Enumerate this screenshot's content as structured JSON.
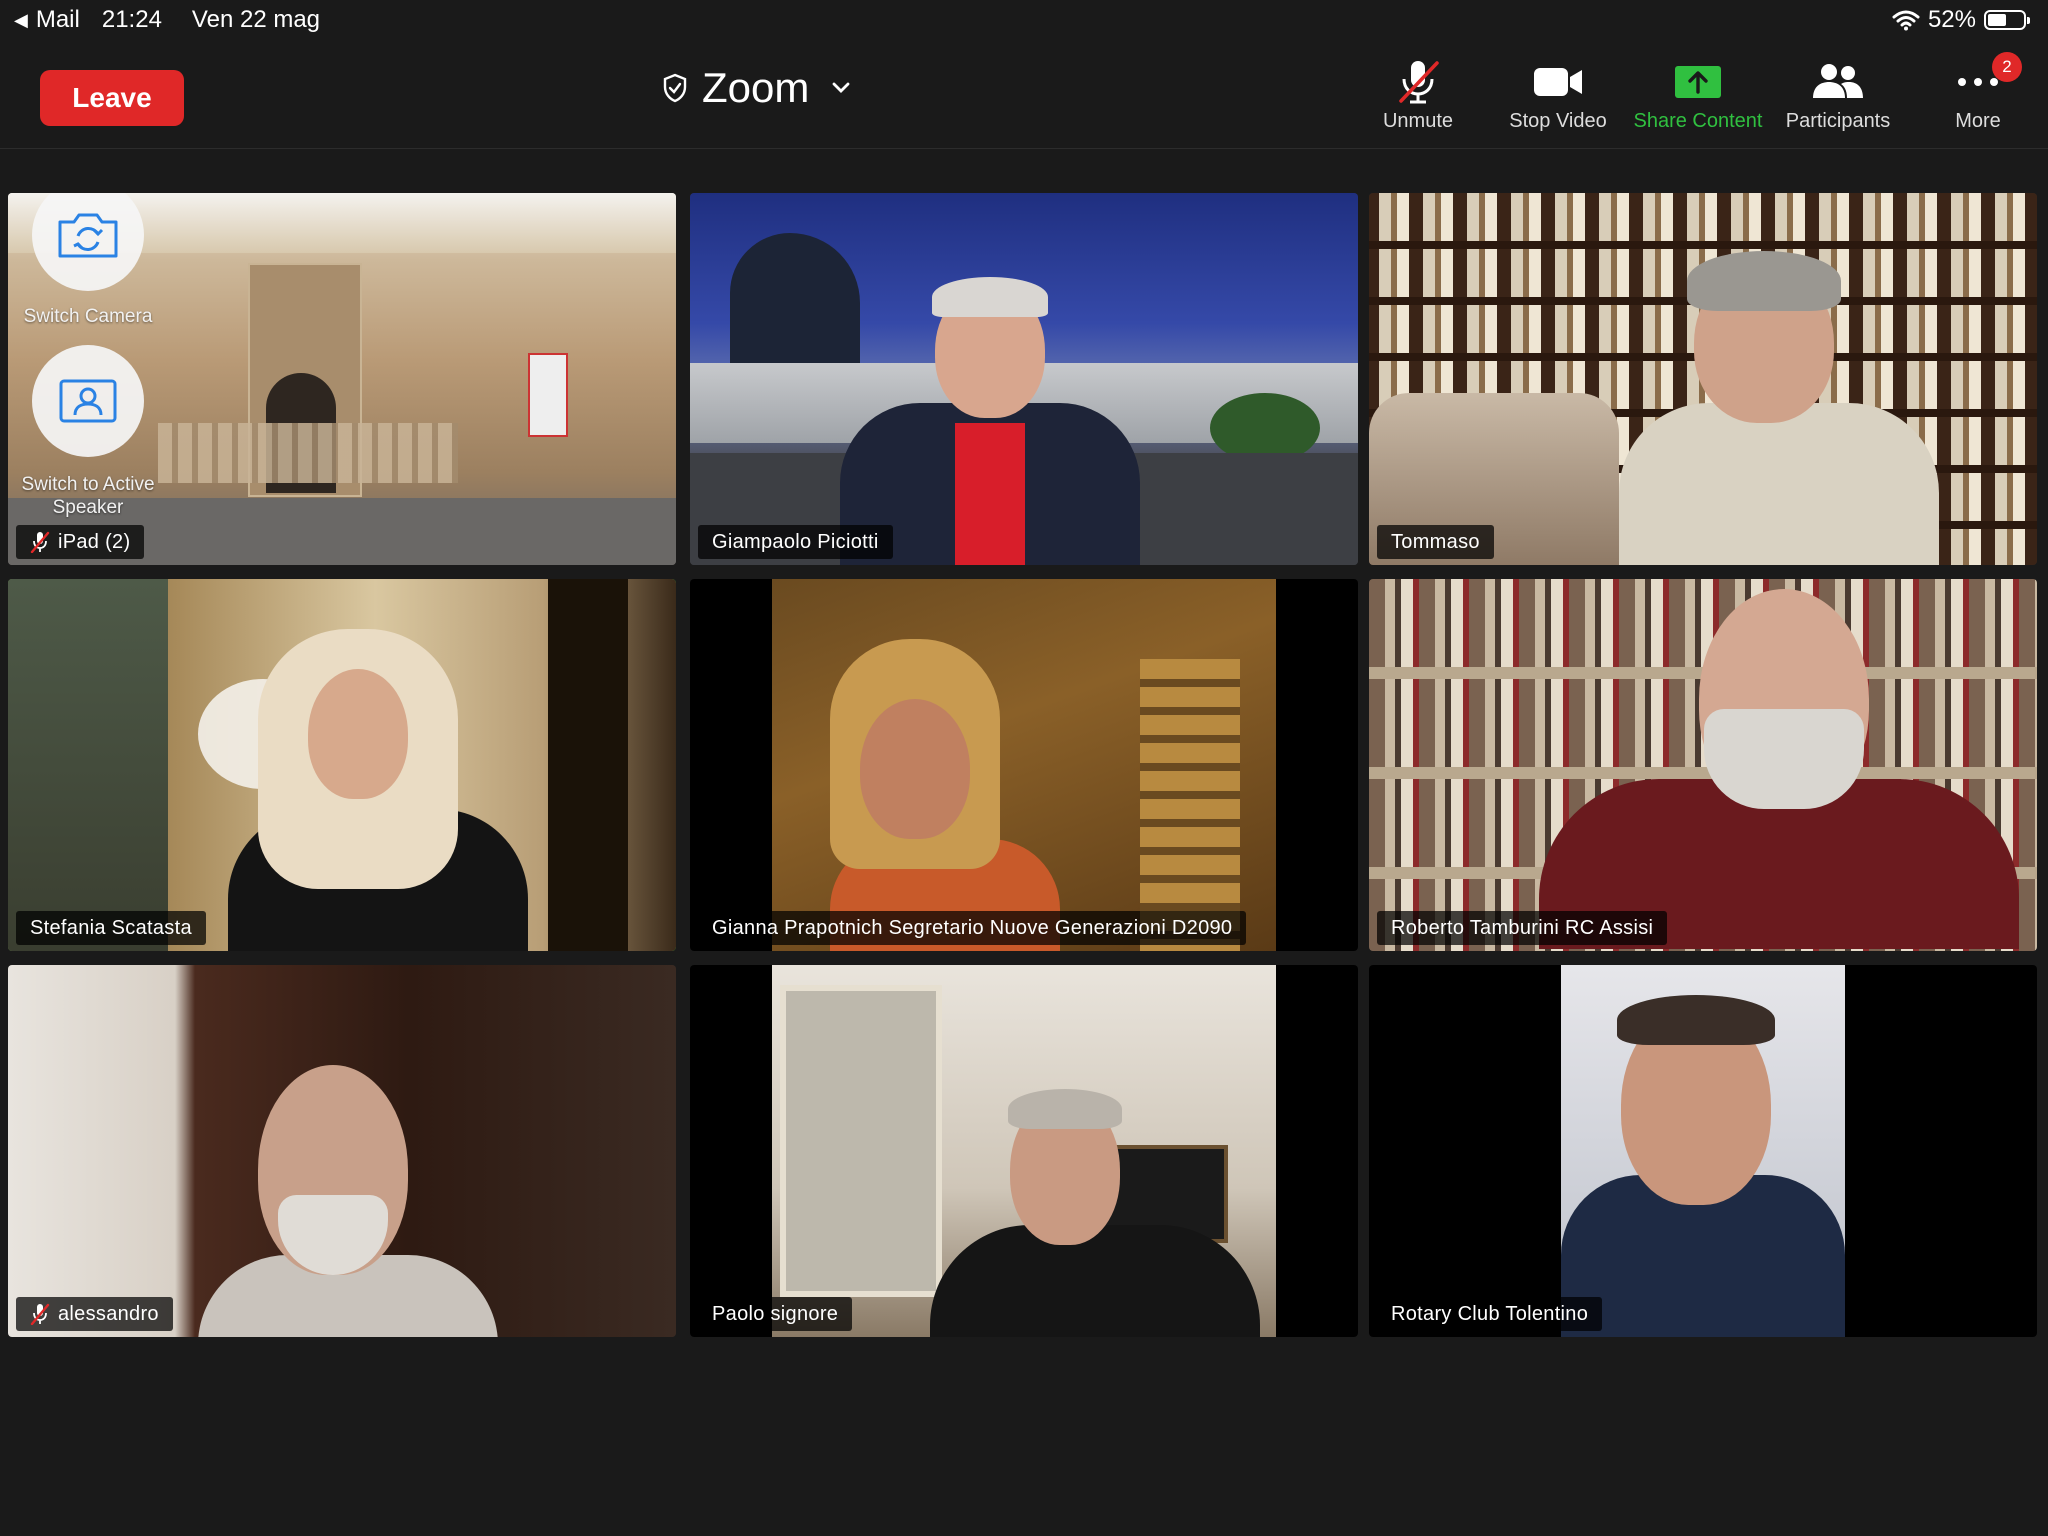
{
  "status_bar": {
    "back_app": "Mail",
    "time": "21:24",
    "date": "Ven 22 mag",
    "battery_percent": "52%",
    "battery_level": 0.52
  },
  "toolbar": {
    "leave_label": "Leave",
    "meeting_title": "Zoom",
    "unmute_label": "Unmute",
    "stop_video_label": "Stop Video",
    "share_label": "Share Content",
    "participants_label": "Participants",
    "more_label": "More",
    "more_badge": "2"
  },
  "self_view": {
    "switch_camera_label": "Switch Camera",
    "switch_speaker_label": "Switch to Active Speaker"
  },
  "tiles": [
    {
      "name": "iPad (2)",
      "muted": true
    },
    {
      "name": "Giampaolo Piciotti",
      "muted": false
    },
    {
      "name": "Tommaso",
      "muted": false
    },
    {
      "name": "Stefania Scatasta",
      "muted": false,
      "active_speaker": true
    },
    {
      "name": "Gianna Prapotnich Segretario Nuove Generazioni   D2090",
      "muted": false
    },
    {
      "name": "Roberto Tamburini RC Assisi",
      "muted": false
    },
    {
      "name": "alessandro",
      "muted": true
    },
    {
      "name": "Paolo signore",
      "muted": false
    },
    {
      "name": "Rotary Club Tolentino",
      "muted": false
    }
  ],
  "colors": {
    "leave": "#e02828",
    "share_active": "#30c040",
    "active_speaker_border": "#2ecc40",
    "background": "#1a1a1a"
  },
  "icons": {
    "unmute": "microphone-muted-icon",
    "stop_video": "video-camera-icon",
    "share": "share-up-arrow-icon",
    "participants": "people-icon",
    "more": "ellipsis-icon"
  }
}
